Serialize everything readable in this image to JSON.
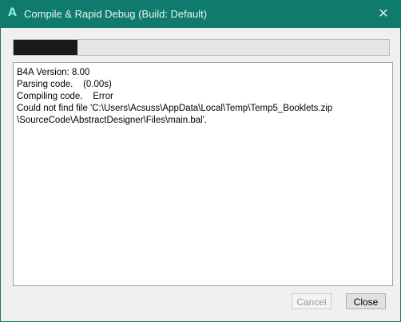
{
  "window": {
    "app_icon": "A",
    "title": "Compile & Rapid Debug (Build: Default)",
    "close_glyph": "✕"
  },
  "progress": {
    "fraction": 0.17
  },
  "log": {
    "lines": [
      "B4A Version: 8.00",
      "Parsing code.    (0.00s)",
      "Compiling code.    Error",
      "Could not find file 'C:\\Users\\Acsuss\\AppData\\Local\\Temp\\Temp5_Booklets.zip",
      "\\SourceCode\\AbstractDesigner\\Files\\main.bal'."
    ]
  },
  "buttons": {
    "cancel_label": "Cancel",
    "close_label": "Close"
  },
  "colors": {
    "titlebar": "#0f7b6c",
    "icon_accent": "#7ff0d6",
    "progress_fill": "#1a1a1a"
  }
}
